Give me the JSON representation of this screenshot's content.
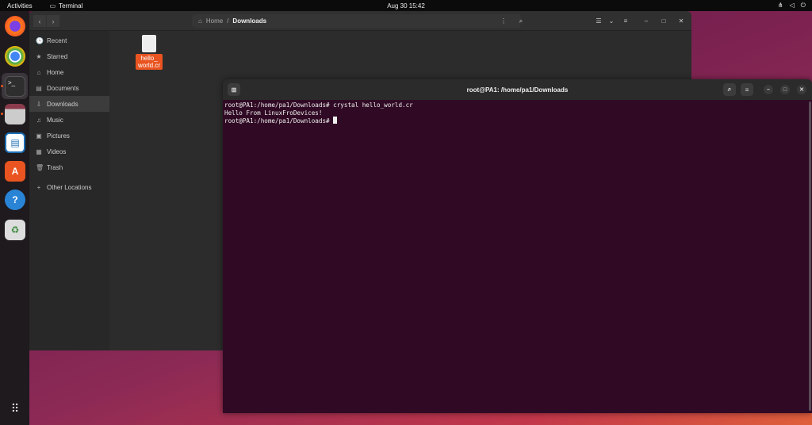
{
  "topbar": {
    "activities": "Activities",
    "app": "Terminal",
    "clock": "Aug 30  15:42",
    "tray": [
      "network-icon",
      "volume-icon",
      "power-icon"
    ]
  },
  "dock": [
    "firefox",
    "chrome",
    "terminal",
    "files",
    "writer",
    "app-center",
    "help",
    "trash"
  ],
  "files": {
    "breadcrumb": {
      "home": "Home",
      "sep": "/",
      "current": "Downloads"
    },
    "sidebar": [
      {
        "icon": "🕓",
        "label": "Recent"
      },
      {
        "icon": "★",
        "label": "Starred"
      },
      {
        "icon": "⌂",
        "label": "Home"
      },
      {
        "icon": "▤",
        "label": "Documents"
      },
      {
        "icon": "⇩",
        "label": "Downloads"
      },
      {
        "icon": "♫",
        "label": "Music"
      },
      {
        "icon": "▣",
        "label": "Pictures"
      },
      {
        "icon": "▦",
        "label": "Videos"
      },
      {
        "icon": "🗑",
        "label": "Trash"
      },
      {
        "icon": "+",
        "label": "Other Locations"
      }
    ],
    "file": {
      "name_line1": "hello_",
      "name_line2": "world.cr"
    }
  },
  "terminal": {
    "title": "root@PA1: /home/pa1/Downloads",
    "lines": [
      "root@PA1:/home/pa1/Downloads# crystal hello_world.cr",
      "Hello From LinuxFroDevices!",
      "root@PA1:/home/pa1/Downloads# "
    ]
  }
}
